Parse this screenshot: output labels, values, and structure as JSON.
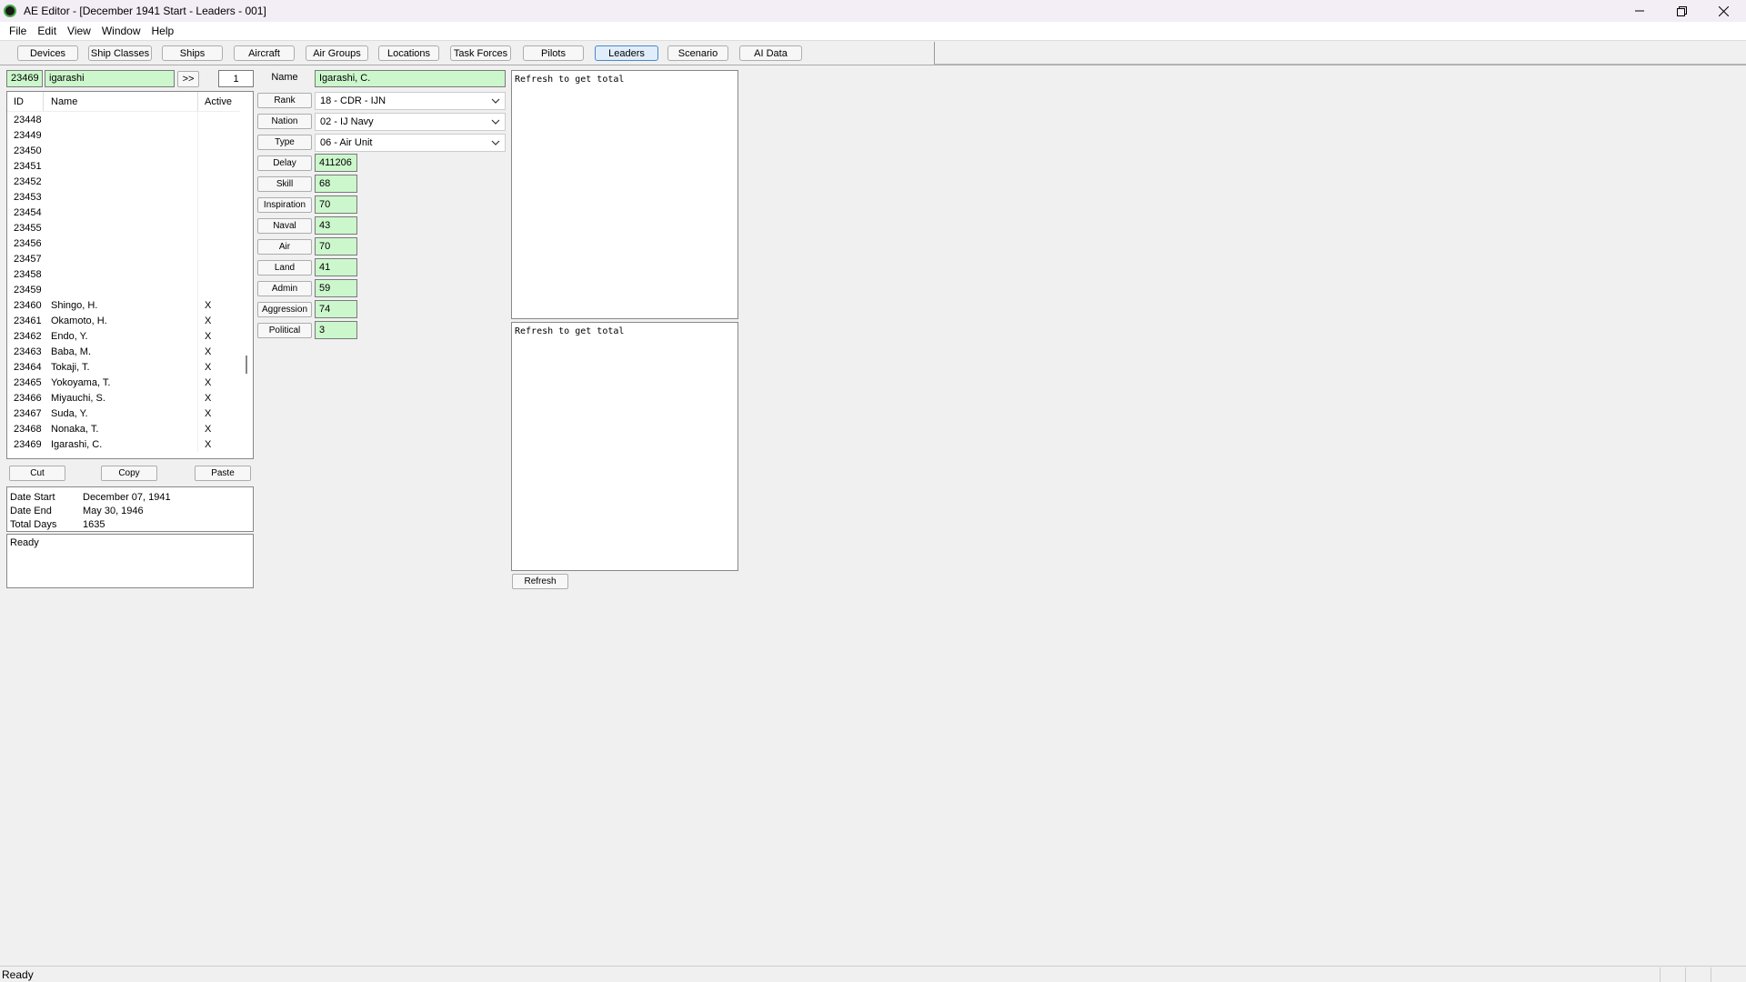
{
  "window": {
    "title": "AE Editor - [December 1941 Start - Leaders - 001]"
  },
  "menu": [
    "File",
    "Edit",
    "View",
    "Window",
    "Help"
  ],
  "toolbar": {
    "tabs": [
      "Devices",
      "Ship Classes",
      "Ships",
      "Aircraft",
      "Air Groups",
      "Locations",
      "Task Forces",
      "Pilots",
      "Leaders",
      "Scenario",
      "AI Data"
    ],
    "active_tab": "Leaders"
  },
  "search": {
    "id_value": "23469",
    "name_value": "igarashi",
    "next_label": ">>",
    "count_value": "1"
  },
  "list": {
    "headers": {
      "id": "ID",
      "name": "Name",
      "active": "Active"
    },
    "rows": [
      {
        "id": "23448",
        "name": "",
        "active": ""
      },
      {
        "id": "23449",
        "name": "",
        "active": ""
      },
      {
        "id": "23450",
        "name": "",
        "active": ""
      },
      {
        "id": "23451",
        "name": "",
        "active": ""
      },
      {
        "id": "23452",
        "name": "",
        "active": ""
      },
      {
        "id": "23453",
        "name": "",
        "active": ""
      },
      {
        "id": "23454",
        "name": "",
        "active": ""
      },
      {
        "id": "23455",
        "name": "",
        "active": ""
      },
      {
        "id": "23456",
        "name": "",
        "active": ""
      },
      {
        "id": "23457",
        "name": "",
        "active": ""
      },
      {
        "id": "23458",
        "name": "",
        "active": ""
      },
      {
        "id": "23459",
        "name": "",
        "active": ""
      },
      {
        "id": "23460",
        "name": "Shingo, H.",
        "active": "X"
      },
      {
        "id": "23461",
        "name": "Okamoto, H.",
        "active": "X"
      },
      {
        "id": "23462",
        "name": "Endo, Y.",
        "active": "X"
      },
      {
        "id": "23463",
        "name": "Baba, M.",
        "active": "X"
      },
      {
        "id": "23464",
        "name": "Tokaji, T.",
        "active": "X"
      },
      {
        "id": "23465",
        "name": "Yokoyama, T.",
        "active": "X"
      },
      {
        "id": "23466",
        "name": "Miyauchi, S.",
        "active": "X"
      },
      {
        "id": "23467",
        "name": "Suda, Y.",
        "active": "X"
      },
      {
        "id": "23468",
        "name": "Nonaka, T.",
        "active": "X"
      },
      {
        "id": "23469",
        "name": "Igarashi, C.",
        "active": "X"
      }
    ]
  },
  "clipboard": {
    "cut": "Cut",
    "copy": "Copy",
    "paste": "Paste"
  },
  "dates": {
    "start_label": "Date Start",
    "start_value": "December 07, 1941",
    "end_label": "Date End",
    "end_value": "May 30, 1946",
    "days_label": "Total Days",
    "days_value": "1635"
  },
  "status_text": "Ready",
  "form": {
    "name_label": "Name",
    "name_value": "Igarashi, C.",
    "rank_label": "Rank",
    "rank_value": "18 - CDR - IJN",
    "nation_label": "Nation",
    "nation_value": "02 - IJ Navy",
    "type_label": "Type",
    "type_value": "06 - Air Unit",
    "fields": [
      {
        "label": "Delay",
        "value": "411206"
      },
      {
        "label": "Skill",
        "value": "68"
      },
      {
        "label": "Inspiration",
        "value": "70"
      },
      {
        "label": "Naval",
        "value": "43"
      },
      {
        "label": "Air",
        "value": "70"
      },
      {
        "label": "Land",
        "value": "41"
      },
      {
        "label": "Admin",
        "value": "59"
      },
      {
        "label": "Aggression",
        "value": "74"
      },
      {
        "label": "Political",
        "value": "3"
      }
    ]
  },
  "panels": {
    "top_text": "Refresh to get total",
    "bottom_text": "Refresh to get total",
    "refresh_label": "Refresh"
  },
  "statusbar": {
    "text": "Ready"
  }
}
